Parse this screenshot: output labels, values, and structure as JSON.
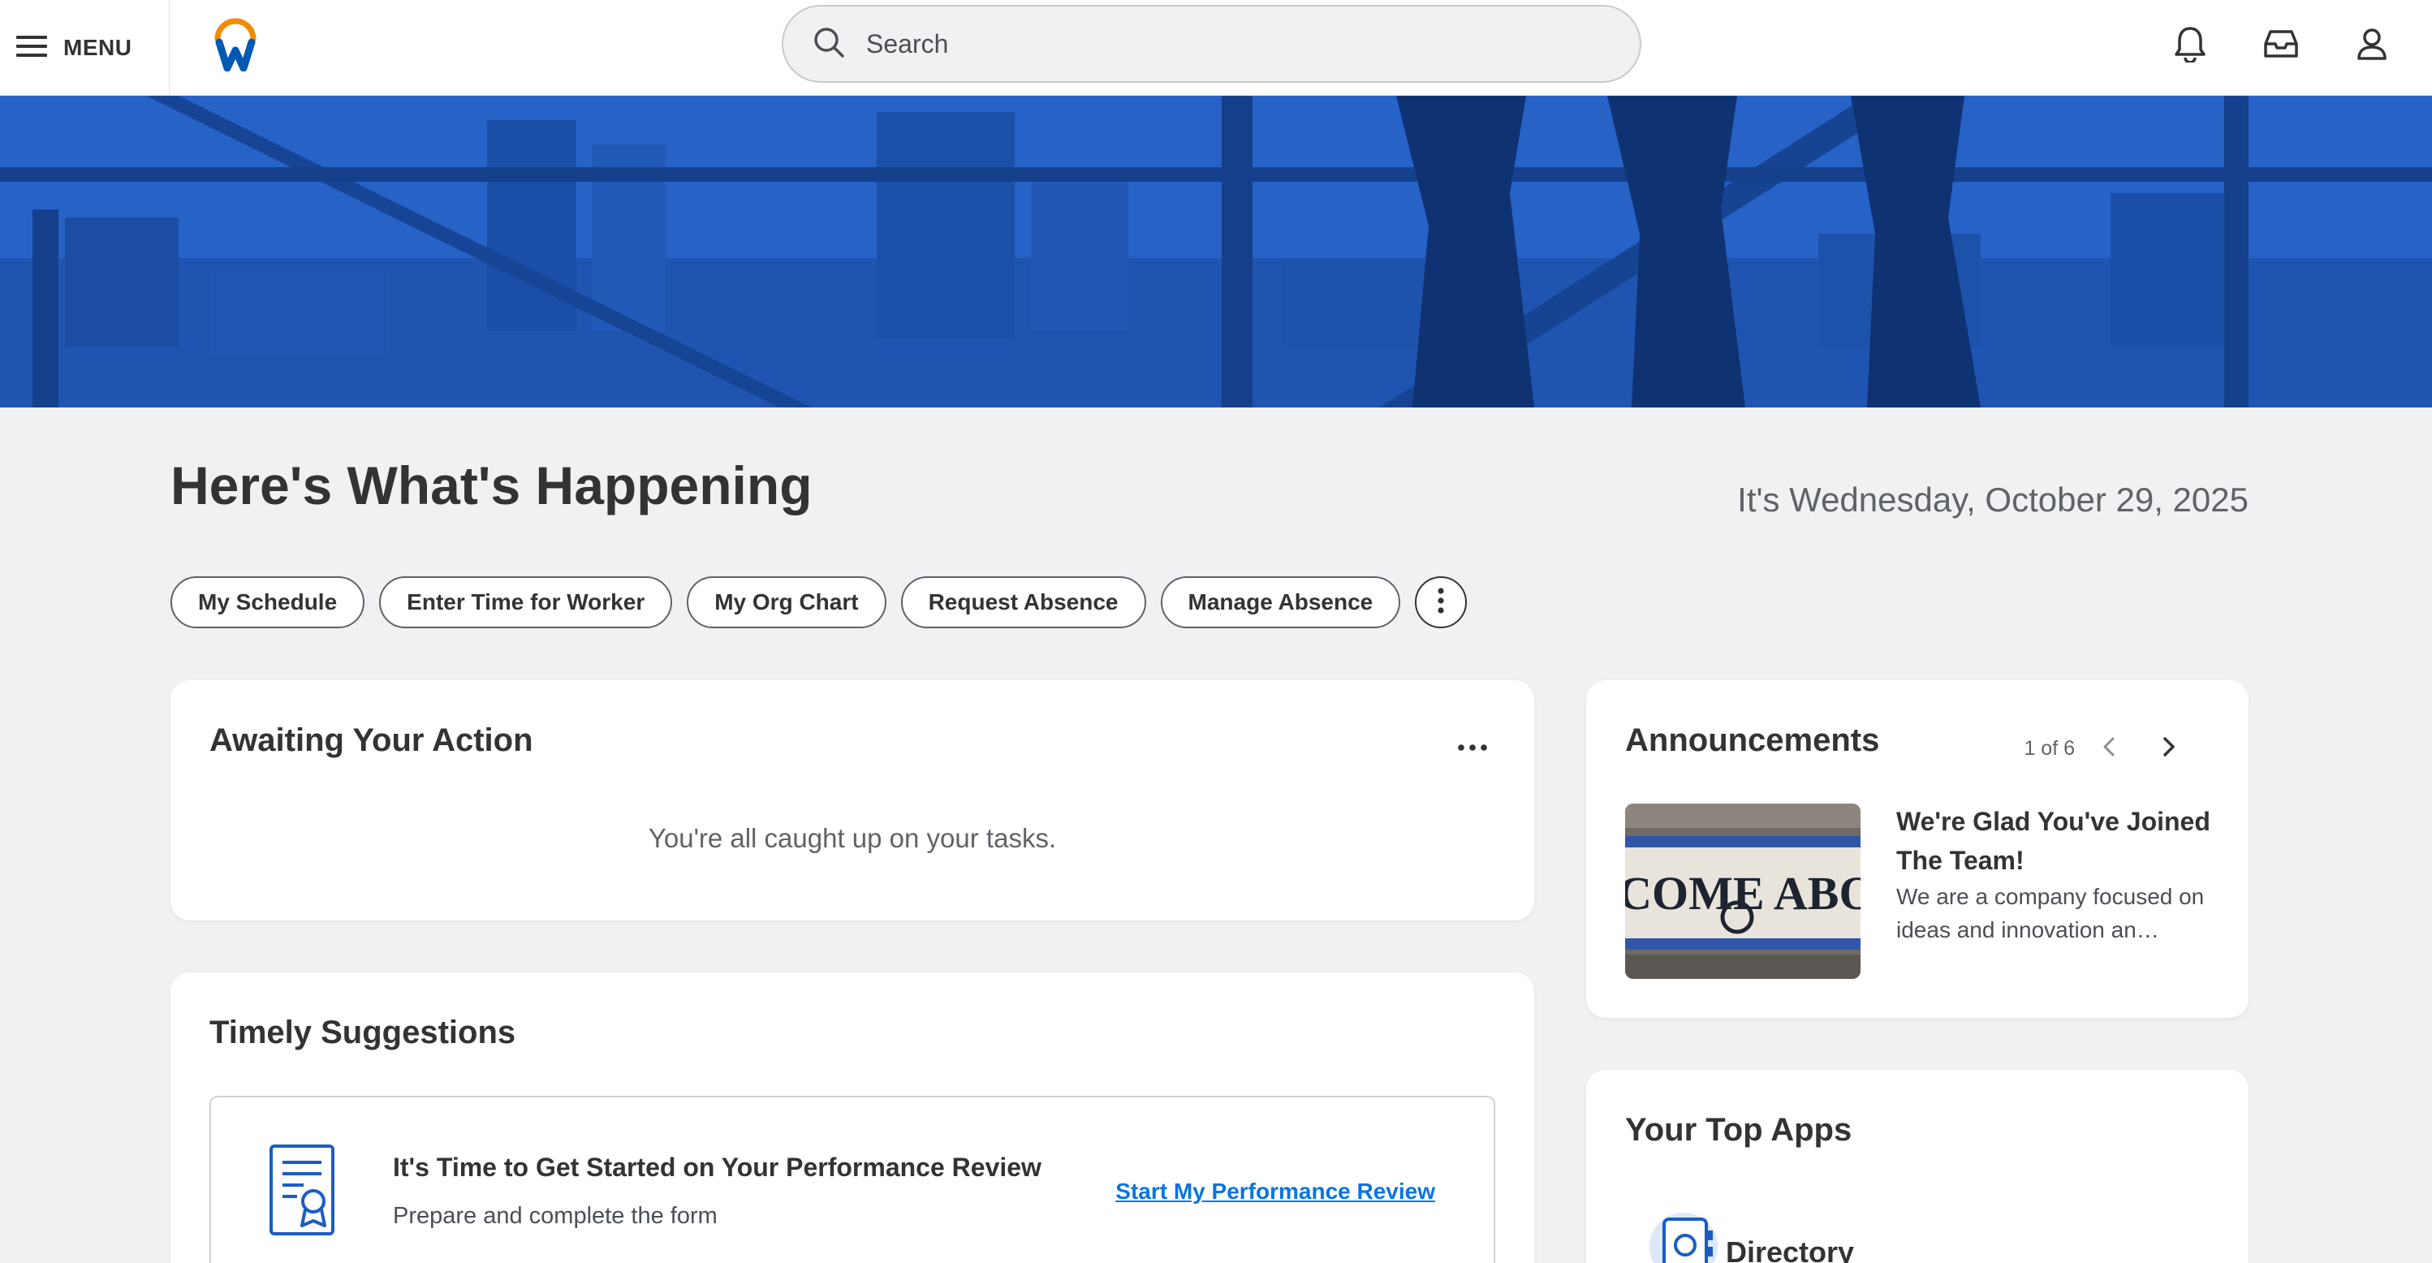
{
  "header": {
    "menu_label": "MENU",
    "search_placeholder": "Search",
    "icons": [
      "menu-icon",
      "workday-logo",
      "search-icon",
      "bell-icon",
      "inbox-icon",
      "profile-icon"
    ],
    "accent_color": "#0875e1",
    "logo_colors": [
      "#f38b00",
      "#0059b3"
    ]
  },
  "hero": {
    "tint_color": "#1d5bbf"
  },
  "page": {
    "title": "Here's What's Happening",
    "date": "It's Wednesday, October 29, 2025"
  },
  "quick_actions": [
    {
      "label": "My Schedule"
    },
    {
      "label": "Enter Time for Worker"
    },
    {
      "label": "My Org Chart"
    },
    {
      "label": "Request Absence"
    },
    {
      "label": "Manage Absence"
    }
  ],
  "awaiting": {
    "title": "Awaiting Your Action",
    "message": "You're all caught up on your tasks."
  },
  "suggestions": {
    "title": "Timely Suggestions",
    "item": {
      "title": "It's Time to Get Started on Your Performance Review",
      "subtitle": "Prepare and complete the form",
      "link": "Start My Performance Review"
    }
  },
  "announcements": {
    "title": "Announcements",
    "pager": "1 of 6",
    "item": {
      "image_text": "WELCOME ABOARD",
      "title": "We're Glad You've Joined The Team!",
      "description": "We are a company focused on ideas and innovation an…"
    }
  },
  "top_apps": {
    "title": "Your Top Apps",
    "apps": [
      {
        "label": "Directory"
      }
    ]
  }
}
